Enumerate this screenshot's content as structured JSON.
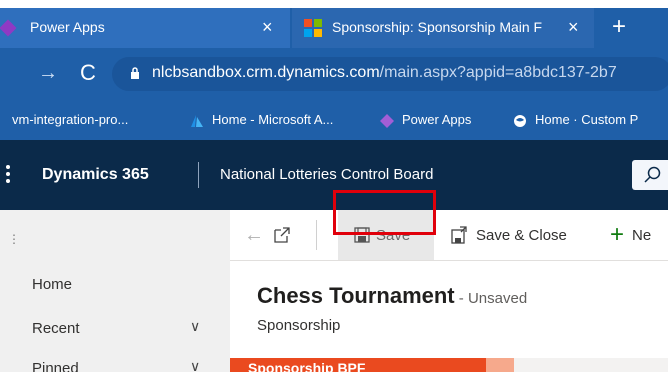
{
  "browser": {
    "tabs": [
      {
        "label": "Power Apps",
        "close": "×"
      },
      {
        "label": "Sponsorship: Sponsorship Main F",
        "close": "×"
      }
    ],
    "new_tab": "+",
    "forward": "→",
    "reload": "C",
    "url_host": "nlcbsandbox.crm.dynamics.com",
    "url_path": "/main.aspx?appid=a8bdc137-2b7",
    "bookmarks": [
      {
        "label": "vm-integration-pro..."
      },
      {
        "label": "Home - Microsoft A..."
      },
      {
        "label": "Power Apps"
      },
      {
        "label": "Home · Custom P"
      }
    ]
  },
  "app": {
    "brand": "Dynamics 365",
    "org": "National Lotteries Control Board"
  },
  "sidebar": {
    "items": [
      {
        "label": "Home"
      },
      {
        "label": "Recent",
        "chevron": "∨"
      },
      {
        "label": "Pinned",
        "chevron": "∨"
      }
    ]
  },
  "commands": {
    "back": "←",
    "save": "Save",
    "save_close": "Save & Close",
    "new": "Ne"
  },
  "form": {
    "title": "Chess Tournament",
    "state": " - Unsaved",
    "entity": "Sponsorship",
    "bpf_stage": "Sponsorship BPF"
  },
  "colors": {
    "browser_chrome": "#1f5fa8",
    "app_header": "#0b2a4a",
    "bpf_active": "#ea4a1f",
    "highlight": "#e0000b"
  }
}
